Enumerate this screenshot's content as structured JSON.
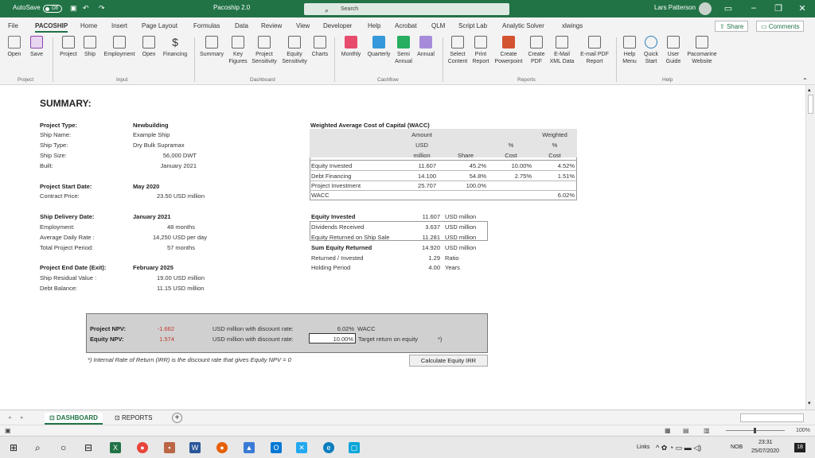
{
  "titlebar": {
    "autosave": "AutoSave",
    "autosave_state": "Off",
    "doc_title": "Pacoship 2.0",
    "search_placeholder": "Search",
    "user": "Lars Patterson"
  },
  "menu": [
    "File",
    "PACOSHIP",
    "Home",
    "Insert",
    "Page Layout",
    "Formulas",
    "Data",
    "Review",
    "View",
    "Developer",
    "Help",
    "Acrobat",
    "QLM",
    "Script Lab",
    "Analytic Solver",
    "xlwings"
  ],
  "share_label": "Share",
  "comments_label": "Comments",
  "ribbon": {
    "buttons": [
      "Open",
      "Save",
      "Project",
      "Ship",
      "Employment",
      "Opex",
      "Financing",
      "Summary",
      "Key Figures",
      "Project Sensitivity",
      "Equity Sensitivity",
      "Charts",
      "Monthly",
      "Quarterly",
      "Semi Annual",
      "Annual",
      "Select Content",
      "Print Report",
      "Create Powerpoint",
      "Create PDF",
      "E-Mail XML Data",
      "E-mail PDF Report",
      "Help Menu",
      "Quick Start",
      "User Guide",
      "Pacomarine Website"
    ],
    "groups": [
      "Project",
      "Input",
      "Dashboard",
      "Cashflow",
      "Reports",
      "Help"
    ]
  },
  "summary": {
    "title": "SUMMARY:",
    "labels": {
      "project_type": "Project Type:",
      "ship_name": "Ship Name:",
      "ship_type": "Ship Type:",
      "ship_size": "Ship Size:",
      "built": "Built:",
      "start_date": "Project Start Date:",
      "contract_price": "Contract Price:",
      "delivery_date": "Ship Delivery Date:",
      "employment": "Employment:",
      "avg_daily_rate": "Average Daily Rate :",
      "total_period": "Total Project Period:",
      "end_date": "Project End Date (Exit):",
      "residual_value": "Ship Residual Value :",
      "debt_balance": "Debt Balance:"
    },
    "values": {
      "project_type": "Newbuilding",
      "ship_name": "Example Ship",
      "ship_type": "Dry Bulk Supramax",
      "ship_size": "56,000 DWT",
      "built": "January 2021",
      "start_date": "May 2020",
      "contract_price": "23.50 USD million",
      "delivery_date": "January 2021",
      "employment": "48 months",
      "avg_daily_rate": "14,250 USD per day",
      "total_period": "57 months",
      "end_date": "February 2025",
      "residual_value": "19.00 USD million",
      "debt_balance": "11.15 USD million"
    }
  },
  "wacc": {
    "title": "Weighted Average Cost of Capital (WACC)",
    "headers": [
      "Amount",
      "USD",
      "million",
      "Share",
      "%",
      "Cost",
      "Weighted",
      "%",
      "Cost"
    ],
    "rows": [
      {
        "label": "Equity Invested",
        "amount": "11.607",
        "share": "45.2%",
        "cost": "10.00%",
        "weighted": "4.52%"
      },
      {
        "label": "Debt Financing",
        "amount": "14.100",
        "share": "54.8%",
        "cost": "2.75%",
        "weighted": "1.51%"
      },
      {
        "label": "Project Investment",
        "amount": "25.707",
        "share": "100.0%",
        "cost": "",
        "weighted": ""
      },
      {
        "label": "WACC",
        "amount": "",
        "share": "",
        "cost": "",
        "weighted": "6.02%"
      }
    ]
  },
  "equity": {
    "rows": [
      {
        "label": "Equity Invested",
        "value": "11.607",
        "unit": "USD million"
      },
      {
        "label": "Dividends Received",
        "value": "3.637",
        "unit": "USD million"
      },
      {
        "label": "Equity Returned on Ship Sale",
        "value": "11.281",
        "unit": "USD million"
      },
      {
        "label": "Sum Equity Returned",
        "value": "14.920",
        "unit": "USD million"
      },
      {
        "label": "Returned / Invested",
        "value": "1.29",
        "unit": "Ratio"
      },
      {
        "label": "Holding Period",
        "value": "4.00",
        "unit": "Years"
      }
    ]
  },
  "npv": {
    "project_label": "Project NPV:",
    "project_value": "-1.662",
    "equity_label": "Equity NPV:",
    "equity_value": "1.574",
    "project_text": "USD million with discount rate:",
    "equity_text": "USD million with discount rate:",
    "project_rate": "6.02%",
    "project_rate_label": "WACC",
    "equity_rate": "10.00%",
    "equity_rate_label": "Target return on equity",
    "star": "*)",
    "footnote": "*) Internal Rate of Return (IRR) is the discount rate that gives Equity NPV = 0",
    "button": "Calculate Equity IRR"
  },
  "tabs": [
    "DASHBOARD",
    "REPORTS"
  ],
  "status": {
    "zoom": "100%"
  },
  "taskbar": {
    "links": "Links",
    "lang": "NOB",
    "time": "23:31",
    "date": "25/07/2020",
    "notif": "18"
  }
}
